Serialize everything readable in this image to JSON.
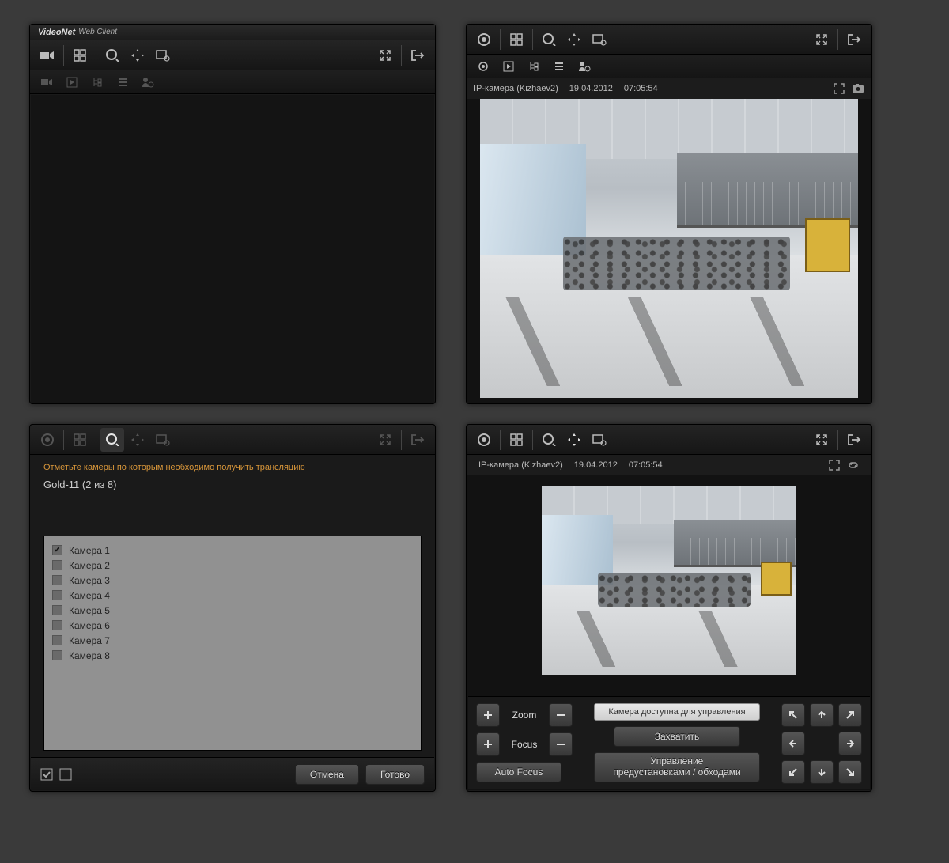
{
  "app": {
    "brand": "VideoNet",
    "brandSub": "Web Client"
  },
  "panel2": {
    "camera": "IP-камера (Kizhaev2)",
    "date": "19.04.2012",
    "time": "07:05:54"
  },
  "panel3": {
    "instruction": "Отметьте камеры по которым необходимо получить трансляцию",
    "group": "Gold-11 (2 из 8)",
    "cameras": [
      {
        "label": "Камера 1",
        "checked": true
      },
      {
        "label": "Камера 2",
        "checked": false
      },
      {
        "label": "Камера 3",
        "checked": false
      },
      {
        "label": "Камера 4",
        "checked": false
      },
      {
        "label": "Камера 5",
        "checked": false
      },
      {
        "label": "Камера 6",
        "checked": false
      },
      {
        "label": "Камера 7",
        "checked": false
      },
      {
        "label": "Камера 8",
        "checked": false
      }
    ],
    "cancel": "Отмена",
    "done": "Готово"
  },
  "panel4": {
    "camera": "IP-камера (Kizhaev2)",
    "date": "19.04.2012",
    "time": "07:05:54",
    "zoom": "Zoom",
    "focus": "Focus",
    "autofocus": "Auto Focus",
    "status": "Камера доступна для управления",
    "capture": "Захватить",
    "presets": "Управление\nпредустановками / обходами"
  }
}
